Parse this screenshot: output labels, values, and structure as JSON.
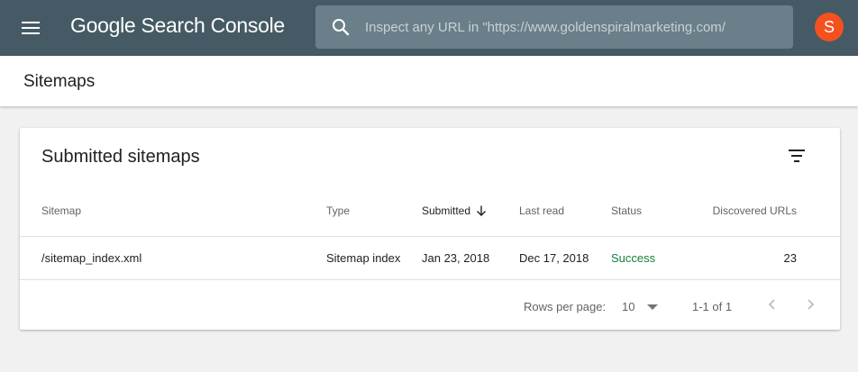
{
  "app": {
    "brand": "Google Search Console",
    "search_placeholder": "Inspect any URL in \"https://www.goldenspiralmarketing.com/",
    "avatar_initial": "S",
    "colors": {
      "topbar": "#455a64",
      "search_bg": "#6a7f89",
      "avatar": "#f4511e",
      "success": "#188038"
    }
  },
  "page": {
    "title": "Sitemaps"
  },
  "card": {
    "title": "Submitted sitemaps",
    "filter_icon": "filter-list-icon",
    "columns": [
      "Sitemap",
      "Type",
      "Submitted",
      "Last read",
      "Status",
      "Discovered URLs"
    ],
    "sorted_column": "Submitted",
    "sort_direction": "descending",
    "rows": [
      {
        "sitemap": "/sitemap_index.xml",
        "type": "Sitemap index",
        "submitted": "Jan 23, 2018",
        "last_read": "Dec 17, 2018",
        "status": "Success",
        "discovered_urls": "23"
      }
    ],
    "footer": {
      "rows_per_page_label": "Rows per page:",
      "rows_per_page_value": "10",
      "range": "1-1 of 1"
    }
  }
}
